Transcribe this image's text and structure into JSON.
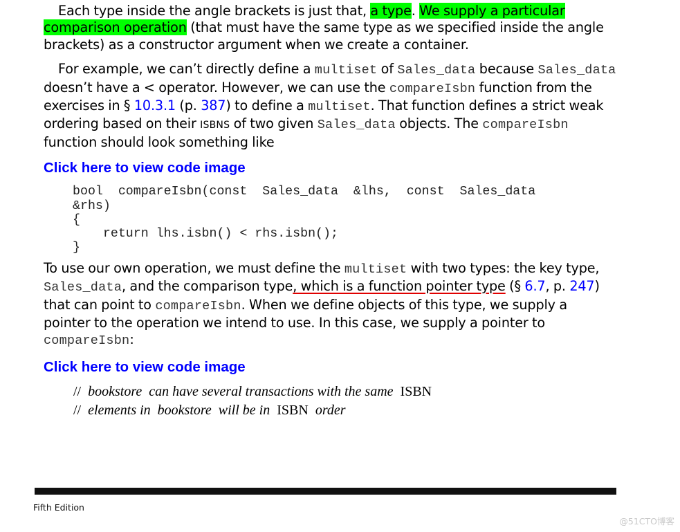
{
  "paragraph1": {
    "t1": "Each type inside the angle brackets is just that, ",
    "hl1": "a type",
    "t2": ". ",
    "hl2": "We supply a particular comparison operation",
    "t3": " (that must have the same type as we specified inside the angle brackets) as a constructor argument when we create a container."
  },
  "paragraph2": {
    "t1": "For example, we can’t directly define a ",
    "c1": "multiset",
    "t2": " of ",
    "c2": "Sales_data",
    "t3": " because ",
    "c3": "Sales_data",
    "t4": " doesn’t have a < operator. However, we can use the ",
    "c4": "compareIsbn",
    "t5": " function from the exercises in § ",
    "link1": "10.3.1",
    "t6": " (p. ",
    "link2": "387",
    "t7": ") to define a ",
    "c5": "multiset",
    "t8": ". That function defines a strict weak ordering based on their ",
    "sc1": "ISBNS",
    "t9": " of two given ",
    "c6": "Sales_data",
    "t10": " objects. The ",
    "c7": "compareIsbn",
    "t11": " function should look something like"
  },
  "code_link_1": "Click here to view code image",
  "code_block_1": {
    "lines": [
      "bool  compareIsbn(const  Sales_data  &lhs,  const  Sales_data",
      "&rhs)",
      "{",
      "    return lhs.isbn() < rhs.isbn();",
      "}"
    ]
  },
  "paragraph3": {
    "t1": "To use our own operation, we must define the ",
    "c1": "multiset",
    "t2": " with two types: the key type, ",
    "c2": "Sales_data",
    "t3": ", and the comparison type",
    "underlined": ", which is a function pointer type",
    "t4": " (§ ",
    "link1": "6.7",
    "t5": ", p. ",
    "link2": "247",
    "t6": ") that can point to ",
    "c3": "compareIsbn",
    "t7": ". When we define objects of this type, we supply a pointer to the operation we intend to use. In this case, we supply a pointer to ",
    "c4": "compareIsbn",
    "t8": ":"
  },
  "code_link_2": "Click here to view code image",
  "code_block_2": {
    "line1": {
      "slashes": "//  ",
      "it1": "bookstore  can have several transactions with the same",
      "plain": "  ISBN"
    },
    "line2": {
      "slashes": "//  ",
      "it1": "elements in  bookstore  will be in",
      "plain": "  ISBN",
      "it2": "  order"
    }
  },
  "footer": {
    "edition": "Fifth Edition",
    "watermark": "@51CTO博客"
  }
}
